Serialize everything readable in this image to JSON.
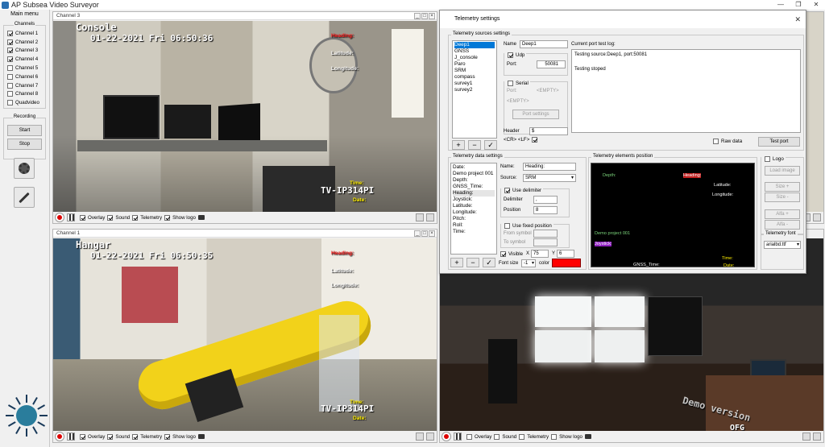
{
  "app": {
    "title": "AP Subsea Video Surveyor",
    "controls": [
      "—",
      "❐",
      "✕"
    ]
  },
  "sidebar": {
    "title": "Main menu",
    "channels_label": "Channels",
    "channels": [
      {
        "label": "Channel 1",
        "checked": true
      },
      {
        "label": "Channel 2",
        "checked": true
      },
      {
        "label": "Channel 3",
        "checked": true
      },
      {
        "label": "Channel 4",
        "checked": true
      },
      {
        "label": "Channel 5",
        "checked": false
      },
      {
        "label": "Channel 6",
        "checked": false
      },
      {
        "label": "Channel 7",
        "checked": false
      },
      {
        "label": "Channel 8",
        "checked": false
      },
      {
        "label": "Quadvideo",
        "checked": false
      }
    ],
    "recording_label": "Recording",
    "start_label": "Start",
    "stop_label": "Stop"
  },
  "channels": {
    "ch3": {
      "title": "Channel 3",
      "cam_name": "Console",
      "timestamp": "01-22-2021 Fri 06:50:36",
      "cam_model": "TV-IP314PI",
      "heading": "Heading:",
      "latitude": "Latitude:",
      "longitude": "Longitude:",
      "time": "Time:",
      "date": "Date:"
    },
    "ch1": {
      "title": "Channel 1",
      "cam_name": "Hangar",
      "timestamp": "01-22-2021 Fri 06:50:35",
      "cam_model": "TV-IP314PI",
      "heading": "Heading:",
      "latitude": "Latitude:",
      "longitude": "Longitude:",
      "time": "Time:",
      "date": "Date:"
    },
    "ch4": {
      "watermark": "Demo version",
      "cam_name": "OFG"
    }
  },
  "toolbar": {
    "overlay": "Overlay",
    "sound": "Sound",
    "telemetry": "Telemetry",
    "show_logo": "Show logo"
  },
  "dialog": {
    "title": "Telemetry settings",
    "sources_label": "Telemetry sources settings",
    "sources": [
      "Deep1",
      "GNSS",
      "J_console",
      "Paro",
      "SRM",
      "compass",
      "survey1",
      "survey2"
    ],
    "selected_source": "Deep1",
    "name_label": "Name",
    "name_value": "Deep1",
    "udp_label": "Udp",
    "port_label": "Port:",
    "port_value": "50081",
    "serial_label": "Serial",
    "serial_port_label": "Port:",
    "serial_port_value": "<EMPTY>",
    "serial_empty": "<EMPTY>",
    "port_settings": "Port settings",
    "header_label": "Header",
    "header_value": "$",
    "crlf_label": "<CR> <LF>",
    "log_label": "Current port test log:",
    "log_lines": [
      "Testing source:Deep1, port:50081",
      "",
      "Testing stoped"
    ],
    "raw_data": "Raw data",
    "test_port": "Test port",
    "data_label": "Telemetry data settings",
    "data_items": [
      "Date:",
      "Demo project 001",
      "Depth:",
      "GNSS_Time:",
      "Heading:",
      "Joystick:",
      "Latitude:",
      "Longitude:",
      "Pitch:",
      "Roll:",
      "Time:"
    ],
    "selected_data": "Heading:",
    "d_name_label": "Name:",
    "d_name_value": "Heading:",
    "source_label": "Source:",
    "source_value": "SRM",
    "use_delimiter": "Use delimiter",
    "delimiter_label": "Delimiter",
    "delimiter_value": ",",
    "position_label": "Position",
    "position_value": "8",
    "use_fixed": "Use fixed position",
    "from_symbol": "From symbol",
    "to_symbol": "To symbol",
    "visible_label": "Visible",
    "x_label": "X",
    "x_value": "75",
    "y_label": "Y",
    "y_value": "6",
    "font_size_label": "Font size",
    "font_size_value": "-1",
    "color_label": "color",
    "elements_label": "Telemetry elements position",
    "logo_label": "Logo",
    "load_image": "Load image",
    "size_plus": "Size +",
    "size_minus": "Size -",
    "alfa_plus": "Alfa +",
    "alfa_minus": "Alfa -",
    "font_label": "Telemetry font",
    "font_value": "arialbd.ttf",
    "preview": {
      "depth": "Depth:",
      "heading": "Heading:",
      "latitude": "Latitude:",
      "longitude": "Longitude:",
      "project": "Demo project 001",
      "joystick": "Joystick:",
      "gnss": "GNSS_Time:",
      "time": "Time:",
      "date": "Date:"
    }
  },
  "colors": {
    "accent": "#0078d7",
    "record": "#dd0000",
    "overlay_red": "#ff2020",
    "overlay_yellow": "#ffee00"
  }
}
